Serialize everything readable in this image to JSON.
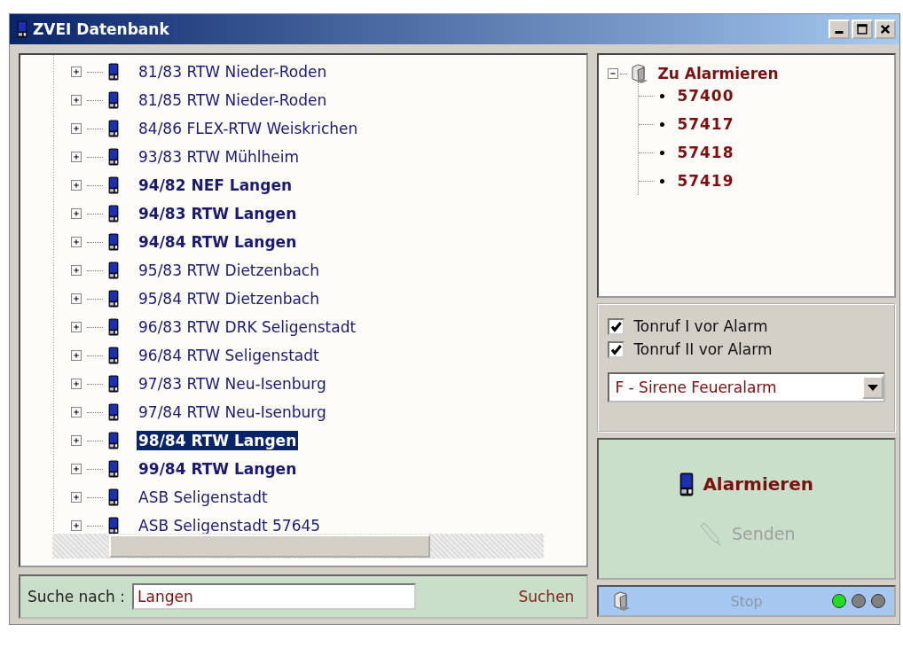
{
  "window": {
    "title": "ZVEI Datenbank"
  },
  "units": [
    {
      "label": "81/83 RTW Nieder-Roden",
      "bold": false,
      "selected": false
    },
    {
      "label": "81/85 RTW Nieder-Roden",
      "bold": false,
      "selected": false
    },
    {
      "label": "84/86 FLEX-RTW Weiskrichen",
      "bold": false,
      "selected": false
    },
    {
      "label": "93/83 RTW Mühlheim",
      "bold": false,
      "selected": false
    },
    {
      "label": "94/82 NEF Langen",
      "bold": true,
      "selected": false
    },
    {
      "label": "94/83 RTW Langen",
      "bold": true,
      "selected": false
    },
    {
      "label": "94/84 RTW Langen",
      "bold": true,
      "selected": false
    },
    {
      "label": "95/83 RTW Dietzenbach",
      "bold": false,
      "selected": false
    },
    {
      "label": "95/84 RTW Dietzenbach",
      "bold": false,
      "selected": false
    },
    {
      "label": "96/83 RTW DRK Seligenstadt",
      "bold": false,
      "selected": false
    },
    {
      "label": "96/84 RTW Seligenstadt",
      "bold": false,
      "selected": false
    },
    {
      "label": "97/83 RTW Neu-Isenburg",
      "bold": false,
      "selected": false
    },
    {
      "label": "97/84 RTW Neu-Isenburg",
      "bold": false,
      "selected": false
    },
    {
      "label": "98/84 RTW Langen",
      "bold": true,
      "selected": true
    },
    {
      "label": "99/84 RTW Langen",
      "bold": true,
      "selected": false
    },
    {
      "label": "ASB Seligenstadt",
      "bold": false,
      "selected": false
    },
    {
      "label": "ASB Seligenstadt 57645",
      "bold": false,
      "selected": false
    }
  ],
  "search": {
    "label": "Suche nach :",
    "value": "Langen",
    "button": "Suchen"
  },
  "alarm_tree": {
    "title": "Zu Alarmieren",
    "expanded": true,
    "children": [
      {
        "label": "57400"
      },
      {
        "label": "57417"
      },
      {
        "label": "57418"
      },
      {
        "label": "57419"
      }
    ]
  },
  "options": [
    {
      "label": "Tonruf I vor Alarm",
      "checked": true
    },
    {
      "label": "Tonruf II vor Alarm",
      "checked": true
    }
  ],
  "signal_select": {
    "value": "F - Sirene Feueralarm"
  },
  "actions": {
    "alarm": {
      "label": "Alarmieren",
      "disabled": false
    },
    "send": {
      "label": "Senden",
      "disabled": true
    }
  },
  "status": {
    "stop": {
      "label": "Stop",
      "disabled": true
    },
    "lights": [
      {
        "color": "#22dd22"
      },
      {
        "color": "#808080"
      },
      {
        "color": "#808080"
      }
    ]
  }
}
